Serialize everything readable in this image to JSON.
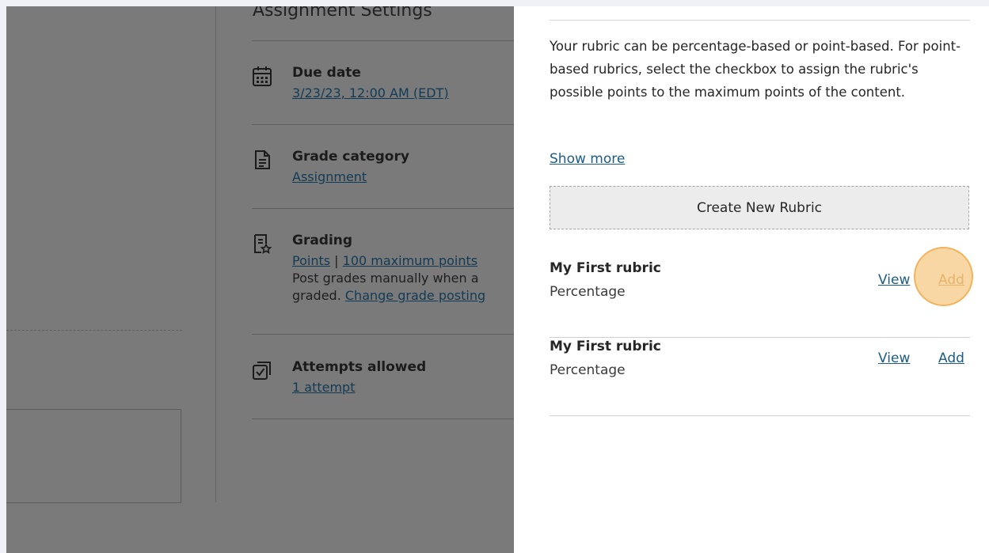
{
  "settings": {
    "title": "Assignment Settings",
    "items": [
      {
        "label": "Due date",
        "link": "3/23/23, 12:00 AM (EDT)"
      },
      {
        "label": "Grade category",
        "link": "Assignment"
      },
      {
        "label": "Grading",
        "link1": "Points",
        "sep": "|",
        "link2": "100 maximum points",
        "text1": "Post grades manually when a",
        "text2a": "graded.",
        "text2link": "Change grade posting"
      },
      {
        "label": "Attempts allowed",
        "link": "1 attempt"
      }
    ]
  },
  "panel": {
    "description": "Your rubric can be percentage-based or point-based. For point-based rubrics, select the checkbox to assign the rubric's possible points to the maximum points of the content.",
    "show_more": "Show more",
    "create_button": "Create New Rubric",
    "rubrics": [
      {
        "name": "My First rubric",
        "type": "Percentage",
        "view": "View",
        "add": "Add"
      },
      {
        "name": "My First rubric",
        "type": "Percentage",
        "view": "View",
        "add": "Add"
      }
    ]
  },
  "colors": {
    "overlay": "#7a7a7a",
    "link": "#1d5c88",
    "highlight": "#f6be6e"
  }
}
